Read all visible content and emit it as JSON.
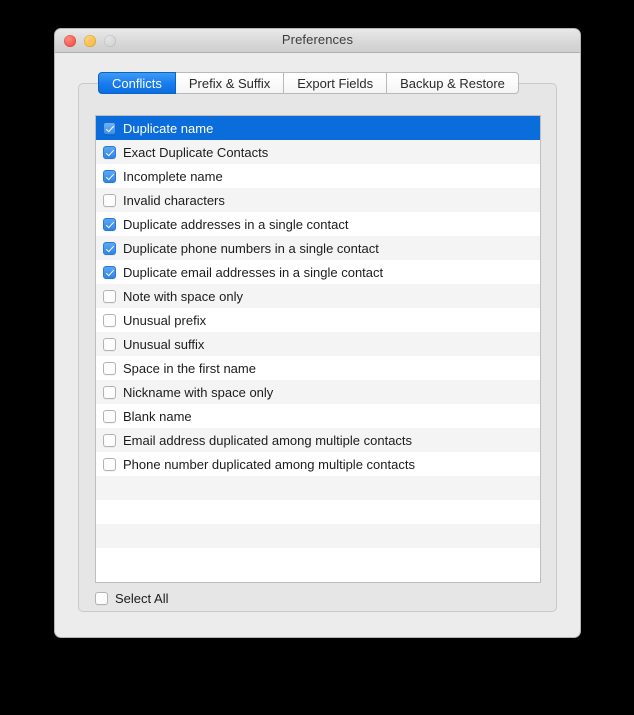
{
  "window": {
    "title": "Preferences",
    "controls": {
      "close": "close-button",
      "minimize": "minimize-button",
      "zoom": "zoom-button"
    }
  },
  "tabs": [
    {
      "label": "Conflicts",
      "active": true
    },
    {
      "label": "Prefix & Suffix",
      "active": false
    },
    {
      "label": "Export Fields",
      "active": false
    },
    {
      "label": "Backup & Restore",
      "active": false
    }
  ],
  "conflicts_list": {
    "items": [
      {
        "label": "Duplicate name",
        "checked": true,
        "selected": true
      },
      {
        "label": "Exact Duplicate Contacts",
        "checked": true,
        "selected": false
      },
      {
        "label": "Incomplete name",
        "checked": true,
        "selected": false
      },
      {
        "label": "Invalid characters",
        "checked": false,
        "selected": false
      },
      {
        "label": "Duplicate addresses in a single contact",
        "checked": true,
        "selected": false
      },
      {
        "label": "Duplicate phone numbers in a single contact",
        "checked": true,
        "selected": false
      },
      {
        "label": "Duplicate email addresses in a single contact",
        "checked": true,
        "selected": false
      },
      {
        "label": "Note with space only",
        "checked": false,
        "selected": false
      },
      {
        "label": "Unusual prefix",
        "checked": false,
        "selected": false
      },
      {
        "label": "Unusual suffix",
        "checked": false,
        "selected": false
      },
      {
        "label": "Space in the first name",
        "checked": false,
        "selected": false
      },
      {
        "label": "Nickname with space only",
        "checked": false,
        "selected": false
      },
      {
        "label": "Blank name",
        "checked": false,
        "selected": false
      },
      {
        "label": "Email address duplicated among multiple contacts",
        "checked": false,
        "selected": false
      },
      {
        "label": "Phone number duplicated among multiple contacts",
        "checked": false,
        "selected": false
      }
    ],
    "empty_rows": 4
  },
  "select_all": {
    "label": "Select All",
    "checked": false
  },
  "colors": {
    "selection_blue": "#0b6cdb",
    "checkbox_blue": "#3b8bf0",
    "active_tab_blue": "#1a7ded",
    "window_background": "#ececec",
    "panel_background": "#e6e6e6",
    "row_alt": "#f4f4f4"
  }
}
